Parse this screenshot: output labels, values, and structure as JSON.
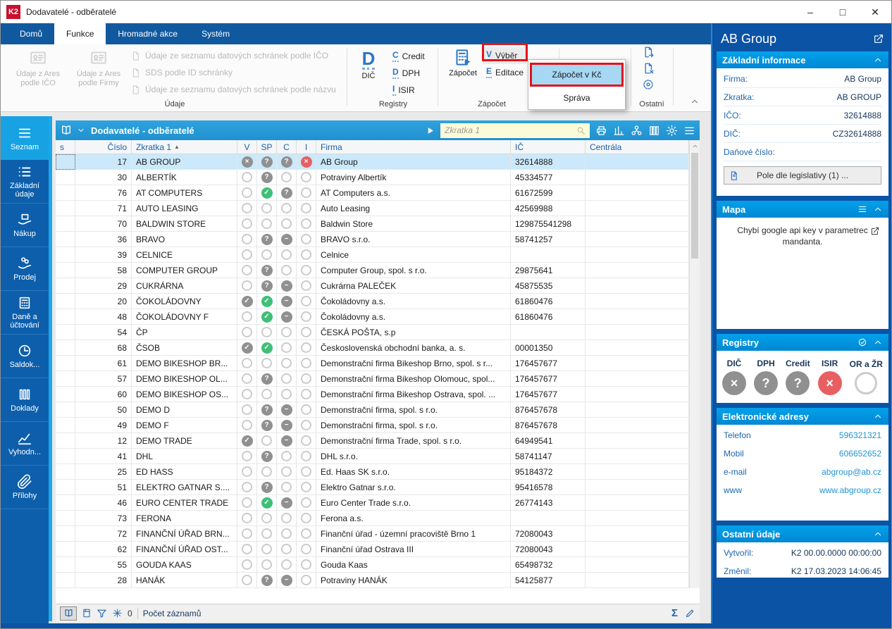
{
  "window": {
    "title": "Dodavatelé - odběratelé",
    "logo_text": "K2",
    "controls": {
      "minimize": "–",
      "maximize": "□",
      "close": "✕"
    }
  },
  "ribbon": {
    "tabs": [
      {
        "label": "Domů",
        "active": false
      },
      {
        "label": "Funkce",
        "active": true
      },
      {
        "label": "Hromadné akce",
        "active": false
      },
      {
        "label": "Systém",
        "active": false
      }
    ],
    "udaje_group": {
      "label": "Údaje",
      "button1_line1": "Údaje z Ares",
      "button1_line2": "podle IČO",
      "button2_line1": "Údaje z Ares",
      "button2_line2": "podle Firmy",
      "menu_items": [
        "Údaje ze seznamu datových schránek podle IČO",
        "SDS podle ID schránky",
        "Údaje ze seznamu datových schránek podle názvu"
      ]
    },
    "registry_group": {
      "label": "Registry",
      "big_letter": "D",
      "big_label": "DIČ",
      "items": [
        {
          "letter": "C",
          "label": "Credit"
        },
        {
          "letter": "D",
          "label": "DPH"
        },
        {
          "letter": "I",
          "label": "ISIR"
        }
      ]
    },
    "zapocet_group": {
      "label": "Zápočet",
      "big_label": "Zápočet",
      "items": [
        {
          "letter": "V",
          "label": "Výběr",
          "boxed": true
        },
        {
          "letter": "E",
          "label": "Editace",
          "boxed": false
        }
      ]
    },
    "ostatni_group": {
      "label": "Ostatní"
    },
    "dropdown_menu": {
      "items": [
        {
          "label": "Zápočet v Kč",
          "highlighted": true
        },
        {
          "label": "Správa",
          "highlighted": false
        }
      ]
    }
  },
  "sidebar": {
    "items": [
      {
        "label": "Seznam",
        "icon": "menu",
        "active": true
      },
      {
        "label": "Základní údaje",
        "icon": "list",
        "active": false
      },
      {
        "label": "Nákup",
        "icon": "purchase",
        "active": false
      },
      {
        "label": "Prodej",
        "icon": "sale",
        "active": false
      },
      {
        "label": "Daně a účtování",
        "icon": "calculator",
        "active": false
      },
      {
        "label": "Saldok...",
        "icon": "clock",
        "active": false
      },
      {
        "label": "Doklady",
        "icon": "books",
        "active": false
      },
      {
        "label": "Vyhodn...",
        "icon": "chart",
        "active": false
      },
      {
        "label": "Přílohy",
        "icon": "paperclip",
        "active": false
      }
    ]
  },
  "table": {
    "toolbar": {
      "title": "Dodavatelé - odběratelé",
      "search_placeholder": "Zkratka 1"
    },
    "columns": [
      "s",
      "Číslo",
      "Zkratka 1",
      "V",
      "SP",
      "C",
      "I",
      "Firma",
      "IČ",
      "Centrála"
    ],
    "sort": {
      "column": "Zkratka 1",
      "direction": "asc"
    },
    "rows": [
      {
        "cislo": "17",
        "zkratka": "AB GROUP",
        "v": "gray-x",
        "sp": "gray-q",
        "c": "gray-q",
        "i": "red-x",
        "firma": "AB Group",
        "ic": "32614888",
        "centrala": "",
        "selected": true
      },
      {
        "cislo": "30",
        "zkratka": "ALBERTÍK",
        "v": "none",
        "sp": "gray-q",
        "c": "none",
        "i": "none",
        "firma": "Potraviny Albertík",
        "ic": "45334577",
        "centrala": "",
        "selected": false
      },
      {
        "cislo": "76",
        "zkratka": "AT COMPUTERS",
        "v": "none",
        "sp": "green-check",
        "c": "gray-q",
        "i": "none",
        "firma": "AT Computers a.s.",
        "ic": "61672599",
        "centrala": "",
        "selected": false
      },
      {
        "cislo": "71",
        "zkratka": "AUTO LEASING",
        "v": "none",
        "sp": "none",
        "c": "none",
        "i": "none",
        "firma": "Auto Leasing",
        "ic": "42569988",
        "centrala": "",
        "selected": false
      },
      {
        "cislo": "70",
        "zkratka": "BALDWIN STORE",
        "v": "none",
        "sp": "none",
        "c": "none",
        "i": "none",
        "firma": "Baldwin Store",
        "ic": "129875541298",
        "centrala": "",
        "selected": false
      },
      {
        "cislo": "36",
        "zkratka": "BRAVO",
        "v": "none",
        "sp": "gray-q",
        "c": "gray-minus",
        "i": "none",
        "firma": "BRAVO s.r.o.",
        "ic": "58741257",
        "centrala": "",
        "selected": false
      },
      {
        "cislo": "39",
        "zkratka": "CELNICE",
        "v": "none",
        "sp": "none",
        "c": "none",
        "i": "none",
        "firma": "Celnice",
        "ic": "",
        "centrala": "",
        "selected": false
      },
      {
        "cislo": "58",
        "zkratka": "COMPUTER GROUP",
        "v": "none",
        "sp": "gray-q",
        "c": "none",
        "i": "none",
        "firma": "Computer Group, spol. s r.o.",
        "ic": "29875641",
        "centrala": "",
        "selected": false
      },
      {
        "cislo": "29",
        "zkratka": "CUKRÁRNA",
        "v": "none",
        "sp": "gray-q",
        "c": "gray-minus",
        "i": "none",
        "firma": "Cukrárna PALEČEK",
        "ic": "45875535",
        "centrala": "",
        "selected": false
      },
      {
        "cislo": "20",
        "zkratka": "ČOKOLÁDOVNY",
        "v": "gray-check",
        "sp": "green-check",
        "c": "gray-minus",
        "i": "none",
        "firma": "Čokoládovny a.s.",
        "ic": "61860476",
        "centrala": "",
        "selected": false
      },
      {
        "cislo": "48",
        "zkratka": "ČOKOLÁDOVNY F",
        "v": "none",
        "sp": "green-check",
        "c": "gray-minus",
        "i": "none",
        "firma": "Čokoládovny a.s.",
        "ic": "61860476",
        "centrala": "",
        "selected": false
      },
      {
        "cislo": "54",
        "zkratka": "ČP",
        "v": "none",
        "sp": "none",
        "c": "none",
        "i": "none",
        "firma": "ČESKÁ POŠTA, s.p",
        "ic": "",
        "centrala": "",
        "selected": false
      },
      {
        "cislo": "68",
        "zkratka": "ČSOB",
        "v": "gray-check",
        "sp": "green-check",
        "c": "none",
        "i": "none",
        "firma": "Československá obchodní banka, a. s.",
        "ic": "00001350",
        "centrala": "",
        "selected": false
      },
      {
        "cislo": "61",
        "zkratka": "DEMO BIKESHOP BR...",
        "v": "none",
        "sp": "none",
        "c": "none",
        "i": "none",
        "firma": "Demonstrační firma Bikeshop Brno, spol. s r...",
        "ic": "176457677",
        "centrala": "",
        "selected": false
      },
      {
        "cislo": "57",
        "zkratka": "DEMO BIKESHOP OL...",
        "v": "none",
        "sp": "gray-q",
        "c": "none",
        "i": "none",
        "firma": "Demonstrační firma Bikeshop Olomouc, spol...",
        "ic": "176457677",
        "centrala": "",
        "selected": false
      },
      {
        "cislo": "60",
        "zkratka": "DEMO BIKESHOP OS...",
        "v": "none",
        "sp": "none",
        "c": "none",
        "i": "none",
        "firma": "Demonstrační firma Bikeshop Ostrava, spol. ...",
        "ic": "176457677",
        "centrala": "",
        "selected": false
      },
      {
        "cislo": "50",
        "zkratka": "DEMO D",
        "v": "none",
        "sp": "gray-q",
        "c": "gray-minus",
        "i": "none",
        "firma": "Demonstrační firma, spol. s r.o.",
        "ic": "876457678",
        "centrala": "",
        "selected": false
      },
      {
        "cislo": "49",
        "zkratka": "DEMO F",
        "v": "none",
        "sp": "gray-q",
        "c": "gray-minus",
        "i": "none",
        "firma": "Demonstrační firma, spol. s r.o.",
        "ic": "876457678",
        "centrala": "",
        "selected": false
      },
      {
        "cislo": "12",
        "zkratka": "DEMO TRADE",
        "v": "gray-check",
        "sp": "none",
        "c": "gray-minus",
        "i": "none",
        "firma": "Demonstrační firma Trade, spol. s r.o.",
        "ic": "64949541",
        "centrala": "",
        "selected": false
      },
      {
        "cislo": "41",
        "zkratka": "DHL",
        "v": "none",
        "sp": "gray-q",
        "c": "none",
        "i": "none",
        "firma": "DHL s.r.o.",
        "ic": "58741147",
        "centrala": "",
        "selected": false
      },
      {
        "cislo": "25",
        "zkratka": "ED HASS",
        "v": "none",
        "sp": "none",
        "c": "none",
        "i": "none",
        "firma": "Ed. Haas SK s.r.o.",
        "ic": "95184372",
        "centrala": "",
        "selected": false
      },
      {
        "cislo": "51",
        "zkratka": "ELEKTRO GATNAR S....",
        "v": "none",
        "sp": "gray-q",
        "c": "none",
        "i": "none",
        "firma": "Elektro Gatnar s.r.o.",
        "ic": "95416578",
        "centrala": "",
        "selected": false
      },
      {
        "cislo": "46",
        "zkratka": "EURO CENTER TRADE",
        "v": "none",
        "sp": "green-check",
        "c": "gray-minus",
        "i": "none",
        "firma": "Euro Center Trade s.r.o.",
        "ic": "26774143",
        "centrala": "",
        "selected": false
      },
      {
        "cislo": "73",
        "zkratka": "FERONA",
        "v": "none",
        "sp": "none",
        "c": "none",
        "i": "none",
        "firma": "Ferona a.s.",
        "ic": "",
        "centrala": "",
        "selected": false
      },
      {
        "cislo": "72",
        "zkratka": "FINANČNÍ ÚŘAD BRN...",
        "v": "none",
        "sp": "none",
        "c": "none",
        "i": "none",
        "firma": "Finanční úřad - územní pracoviště Brno 1",
        "ic": "72080043",
        "centrala": "",
        "selected": false
      },
      {
        "cislo": "62",
        "zkratka": "FINANČNÍ ÚŘAD OST...",
        "v": "none",
        "sp": "none",
        "c": "none",
        "i": "none",
        "firma": "Finanční úřad Ostrava III",
        "ic": "72080043",
        "centrala": "",
        "selected": false
      },
      {
        "cislo": "55",
        "zkratka": "GOUDA KAAS",
        "v": "none",
        "sp": "none",
        "c": "none",
        "i": "none",
        "firma": "Gouda Kaas",
        "ic": "65498732",
        "centrala": "",
        "selected": false
      },
      {
        "cislo": "28",
        "zkratka": "HANÁK",
        "v": "none",
        "sp": "gray-q",
        "c": "gray-minus",
        "i": "none",
        "firma": "Potraviny HANÁK",
        "ic": "54125877",
        "centrala": "",
        "selected": false
      }
    ]
  },
  "statusbar": {
    "filter_count": "0",
    "records_label": "Počet záznamů"
  },
  "sidepanel": {
    "title": "AB Group",
    "basic_info": {
      "header": "Základní informace",
      "fields": [
        {
          "label": "Firma:",
          "value": "AB Group"
        },
        {
          "label": "Zkratka:",
          "value": "AB GROUP"
        },
        {
          "label": "IČO:",
          "value": "32614888"
        },
        {
          "label": "DIČ:",
          "value": "CZ32614888"
        },
        {
          "label": "Daňové číslo:",
          "value": ""
        }
      ],
      "button_label": "Pole dle legislativy (1) ..."
    },
    "map": {
      "header": "Mapa",
      "message": "Chybí google api key v parametrec mandanta."
    },
    "registry": {
      "header": "Registry",
      "items": [
        {
          "label": "DIČ",
          "status": "gray-x"
        },
        {
          "label": "DPH",
          "status": "gray-q"
        },
        {
          "label": "Credit",
          "status": "gray-q"
        },
        {
          "label": "ISIR",
          "status": "red-x"
        },
        {
          "label": "OR a ŽR",
          "status": "none"
        }
      ]
    },
    "addresses": {
      "header": "Elektronické adresy",
      "fields": [
        {
          "label": "Telefon",
          "value": "596321321"
        },
        {
          "label": "Mobil",
          "value": "606652652"
        },
        {
          "label": "e-mail",
          "value": "abgroup@ab.cz"
        },
        {
          "label": "www",
          "value": "www.abgroup.cz"
        }
      ]
    },
    "other": {
      "header": "Ostatní údaje",
      "fields": [
        {
          "label": "Vytvořil:",
          "value": "K2 00.00.0000 00:00:00"
        },
        {
          "label": "Změnil:",
          "value": "K2 17.03.2023 14:06:45"
        }
      ]
    }
  },
  "colors": {
    "ribbon_blue": "#11599F",
    "sidebar_blue": "#0D5FAC",
    "active_cyan": "#17A2E4",
    "toolbar_blue": "#2697D4",
    "panel_blue": "#0B53A5",
    "section_header_blue": "#019EE9",
    "selected_row": "#CBE9FA",
    "annotation_red": "#E3131B",
    "menu_highlight": "#A6D7F3",
    "circle_gray": "#909090",
    "circle_green": "#3FBF77",
    "circle_red": "#E85F62",
    "link_blue": "#2095D5",
    "label_blue": "#1C66AE",
    "value_navy": "#16365C"
  }
}
